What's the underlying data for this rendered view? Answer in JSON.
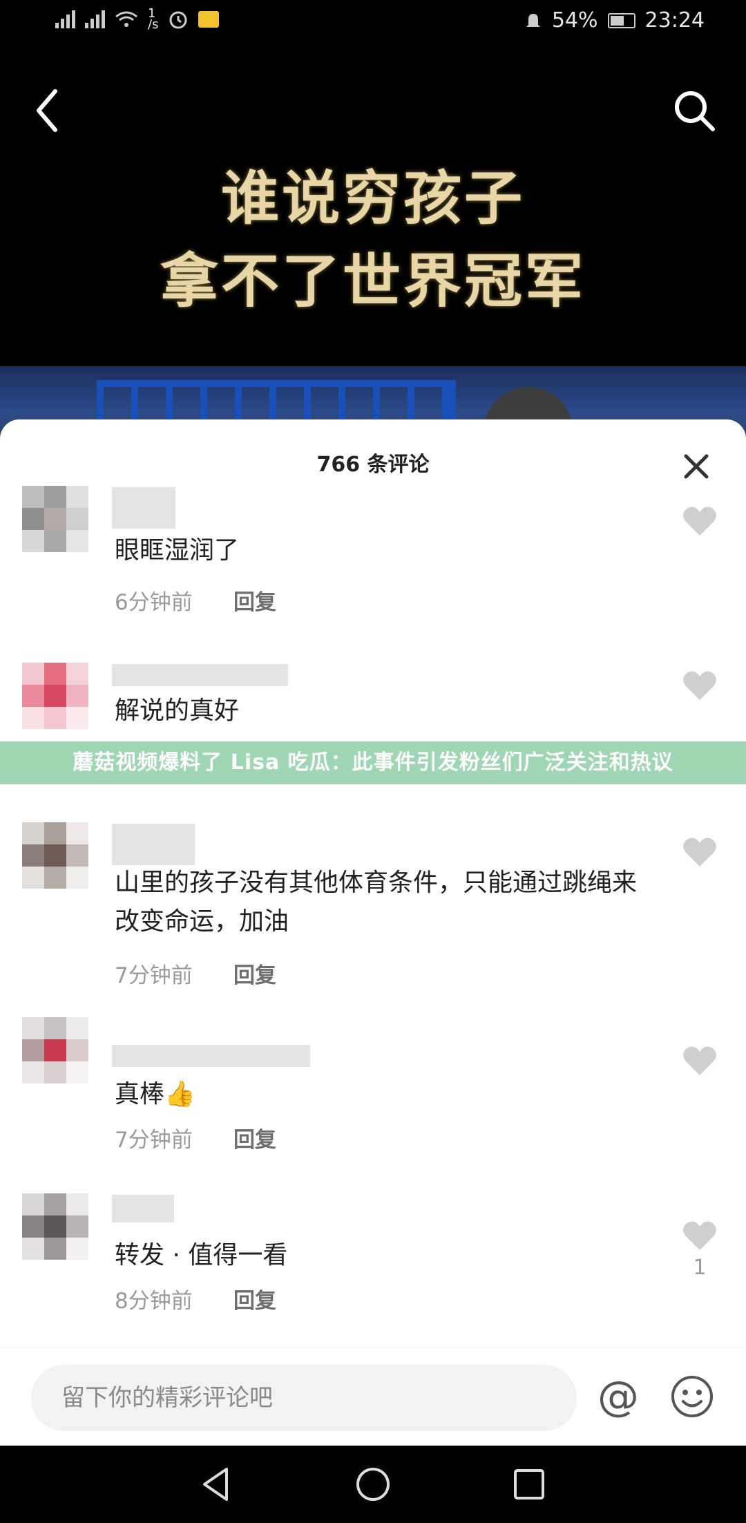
{
  "status_bar": {
    "network_speed": "1",
    "network_unit": "/s",
    "battery": "54%",
    "time": "23:24"
  },
  "video": {
    "title_line1": "谁说穷孩子",
    "title_line2": "拿不了世界冠军"
  },
  "comments_panel": {
    "title": "766 条评论",
    "reply_label": "回复",
    "comments": [
      {
        "text": "眼眶湿润了",
        "time": "6分钟前",
        "likes": ""
      },
      {
        "text": "解说的真好",
        "time": "",
        "likes": ""
      },
      {
        "text": "山里的孩子没有其他体育条件，只能通过跳绳来改变命运，加油",
        "time": "7分钟前",
        "likes": ""
      },
      {
        "text": "真棒👍",
        "time": "7分钟前",
        "likes": ""
      },
      {
        "text": "转发 · 值得一看",
        "time": "8分钟前",
        "likes": "1"
      }
    ]
  },
  "banner": {
    "text": "蘑菇视频爆料了 Lisa 吃瓜：此事件引发粉丝们广泛关注和热议"
  },
  "input": {
    "placeholder": "留下你的精彩评论吧",
    "at_symbol": "@"
  },
  "colors": {
    "banner_bg": "#9fd6b4",
    "title_gold": "#e8d6a6",
    "sheet_bg": "#ffffff"
  }
}
